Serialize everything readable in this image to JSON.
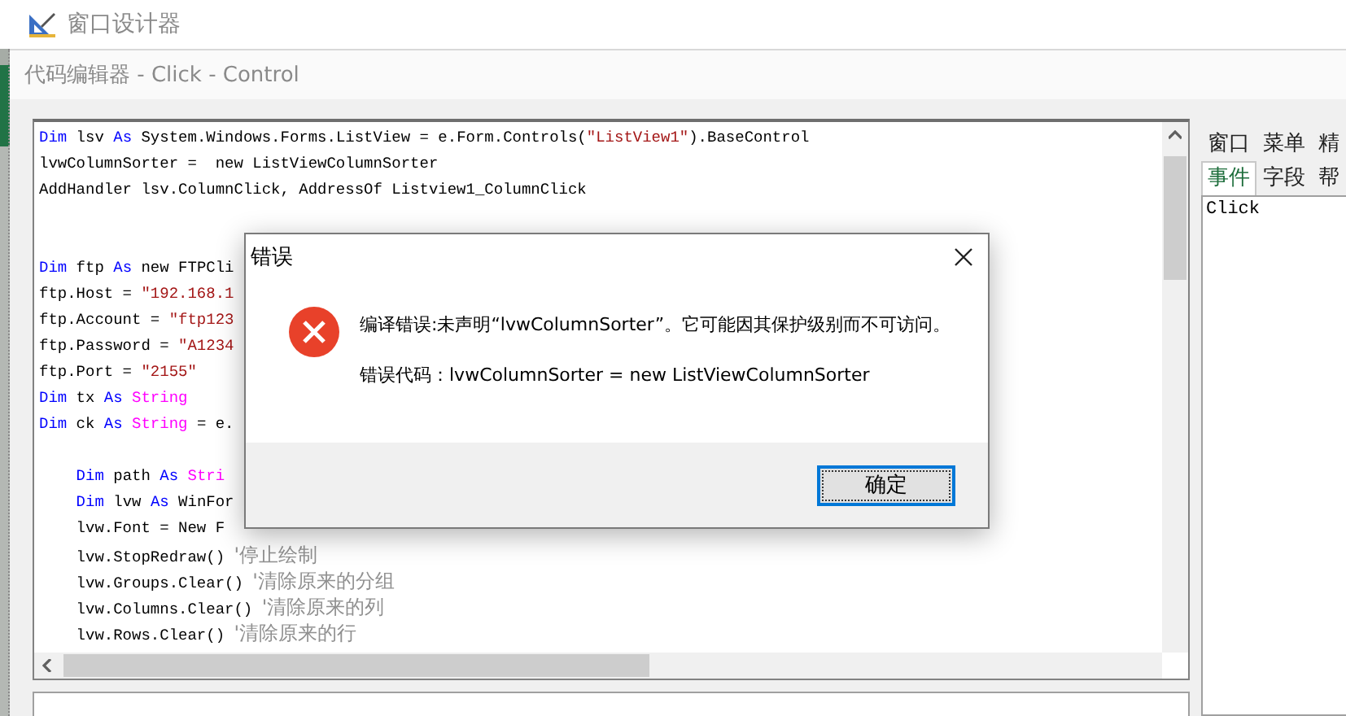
{
  "window": {
    "title": "窗口设计器"
  },
  "editor": {
    "title": "代码编辑器 - Click - Control",
    "lines": [
      {
        "kind": "code",
        "tokens": [
          {
            "kind": "kw",
            "text": "Dim"
          },
          {
            "kind": "plain",
            "text": " lsv "
          },
          {
            "kind": "kw",
            "text": "As"
          },
          {
            "kind": "plain",
            "text": " System.Windows.Forms.ListView = e.Form.Controls("
          },
          {
            "kind": "str",
            "text": "\"ListView1\""
          },
          {
            "kind": "plain",
            "text": ").BaseControl"
          }
        ]
      },
      {
        "kind": "code",
        "tokens": [
          {
            "kind": "plain",
            "text": "lvwColumnSorter =  new ListViewColumnSorter"
          }
        ]
      },
      {
        "kind": "code",
        "tokens": [
          {
            "kind": "plain",
            "text": "AddHandler lsv.ColumnClick, AddressOf Listview1_ColumnClick"
          }
        ]
      },
      {
        "kind": "blank"
      },
      {
        "kind": "blank"
      },
      {
        "kind": "code",
        "tokens": [
          {
            "kind": "kw",
            "text": "Dim"
          },
          {
            "kind": "plain",
            "text": " ftp "
          },
          {
            "kind": "kw",
            "text": "As"
          },
          {
            "kind": "plain",
            "text": " new FTPCli"
          }
        ]
      },
      {
        "kind": "code",
        "tokens": [
          {
            "kind": "plain",
            "text": "ftp.Host = "
          },
          {
            "kind": "str",
            "text": "\"192.168.1"
          }
        ]
      },
      {
        "kind": "code",
        "tokens": [
          {
            "kind": "plain",
            "text": "ftp.Account = "
          },
          {
            "kind": "str",
            "text": "\"ftp123"
          }
        ]
      },
      {
        "kind": "code",
        "tokens": [
          {
            "kind": "plain",
            "text": "ftp.Password = "
          },
          {
            "kind": "str",
            "text": "\"A1234"
          }
        ]
      },
      {
        "kind": "code",
        "tokens": [
          {
            "kind": "plain",
            "text": "ftp.Port = "
          },
          {
            "kind": "str",
            "text": "\"2155\""
          }
        ]
      },
      {
        "kind": "code",
        "tokens": [
          {
            "kind": "kw",
            "text": "Dim"
          },
          {
            "kind": "plain",
            "text": " tx "
          },
          {
            "kind": "kw",
            "text": "As"
          },
          {
            "kind": "type",
            "text": " String"
          }
        ]
      },
      {
        "kind": "code",
        "tokens": [
          {
            "kind": "kw",
            "text": "Dim"
          },
          {
            "kind": "plain",
            "text": " ck "
          },
          {
            "kind": "kw",
            "text": "As"
          },
          {
            "kind": "type",
            "text": " String"
          },
          {
            "kind": "plain",
            "text": " = e."
          }
        ]
      },
      {
        "kind": "blank"
      },
      {
        "kind": "code",
        "tokens": [
          {
            "kind": "kw",
            "text": "    Dim"
          },
          {
            "kind": "plain",
            "text": " path "
          },
          {
            "kind": "kw",
            "text": "As"
          },
          {
            "kind": "type",
            "text": " Stri"
          }
        ]
      },
      {
        "kind": "code",
        "tokens": [
          {
            "kind": "kw",
            "text": "    Dim"
          },
          {
            "kind": "plain",
            "text": " lvw "
          },
          {
            "kind": "kw",
            "text": "As"
          },
          {
            "kind": "plain",
            "text": " WinFor"
          }
        ]
      },
      {
        "kind": "code",
        "tokens": [
          {
            "kind": "plain",
            "text": "    lvw.Font = New F"
          }
        ]
      },
      {
        "kind": "code",
        "tokens": [
          {
            "kind": "plain",
            "text": "    lvw.StopRedraw() "
          },
          {
            "kind": "cm",
            "text": "'停止绘制"
          }
        ]
      },
      {
        "kind": "code",
        "tokens": [
          {
            "kind": "plain",
            "text": "    lvw.Groups.Clear() "
          },
          {
            "kind": "cm",
            "text": "'清除原来的分组"
          }
        ]
      },
      {
        "kind": "code",
        "tokens": [
          {
            "kind": "plain",
            "text": "    lvw.Columns.Clear() "
          },
          {
            "kind": "cm",
            "text": "'清除原来的列"
          }
        ]
      },
      {
        "kind": "code",
        "tokens": [
          {
            "kind": "plain",
            "text": "    lvw.Rows.Clear() "
          },
          {
            "kind": "cm",
            "text": "'清除原来的行"
          }
        ]
      }
    ]
  },
  "side_panel": {
    "tab_rows": [
      [
        {
          "label": "窗口",
          "selected": false
        },
        {
          "label": "菜单",
          "selected": false
        },
        {
          "label": "精",
          "selected": false
        }
      ],
      [
        {
          "label": "事件",
          "selected": true
        },
        {
          "label": "字段",
          "selected": false
        },
        {
          "label": "帮",
          "selected": false
        }
      ]
    ],
    "list": [
      "Click"
    ]
  },
  "dialog": {
    "title": "错误",
    "message": "编译错误:未声明“lvwColumnSorter”。它可能因其保护级别而不可访问。",
    "detail": "错误代码：lvwColumnSorter =  new ListViewColumnSorter",
    "button": "确定"
  }
}
